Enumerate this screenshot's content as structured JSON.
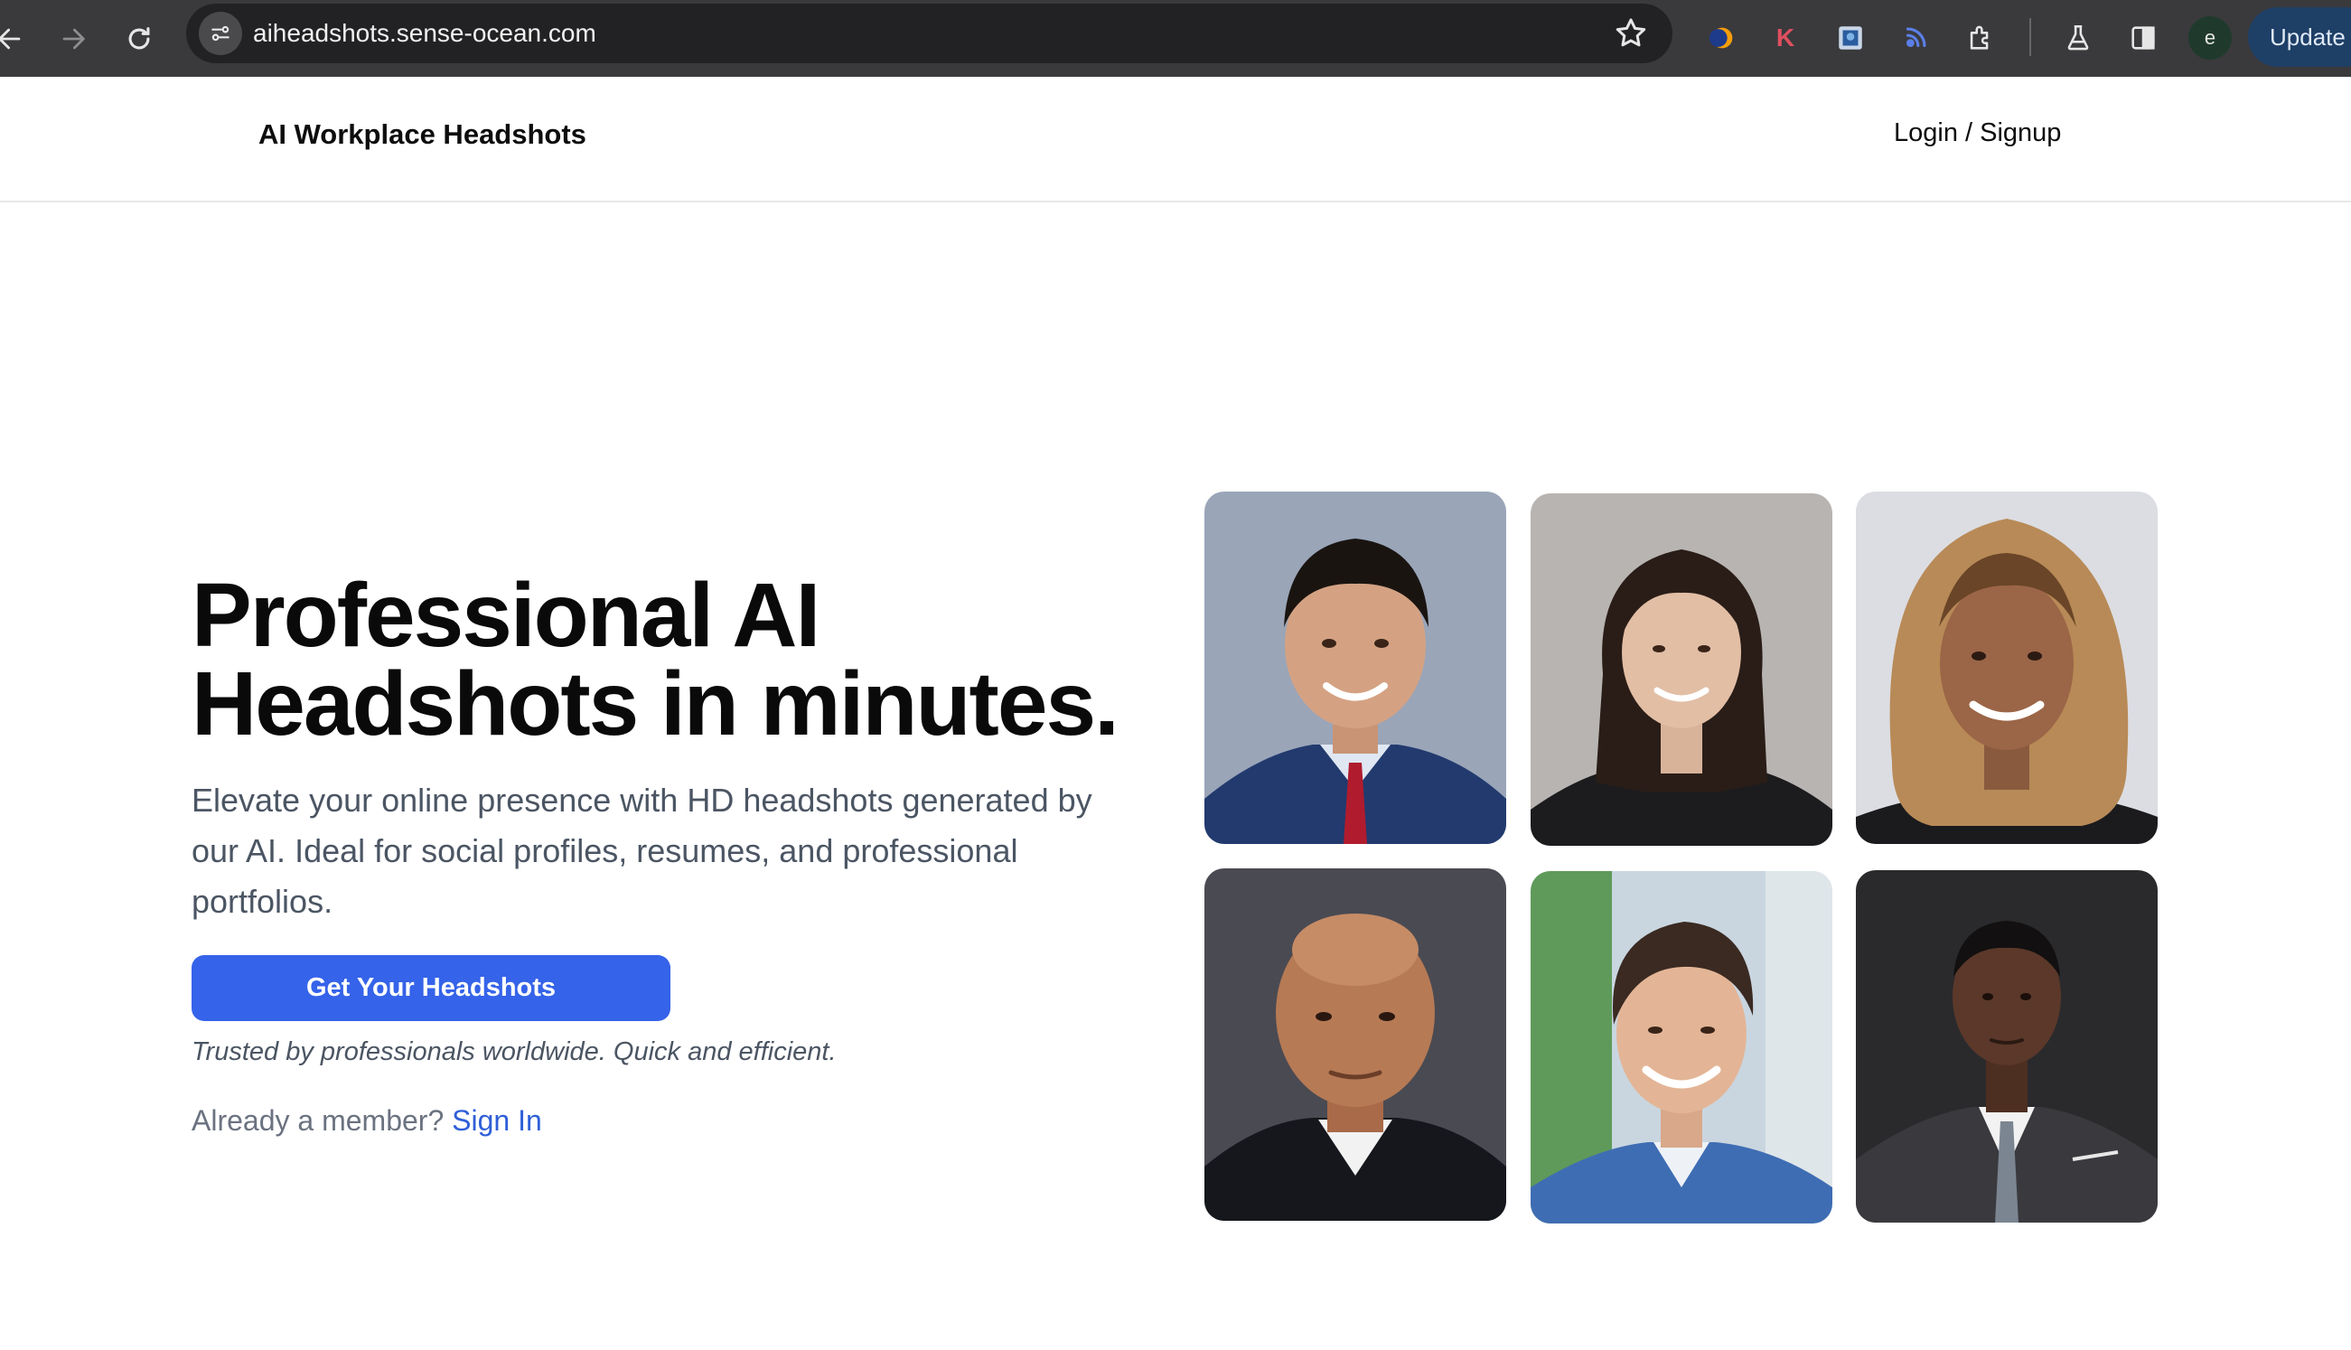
{
  "browser": {
    "url": "aiheadshots.sense-ocean.com",
    "update_label": "Update",
    "profile_initial": "e",
    "extension_k_label": "K",
    "icons": [
      "back-icon",
      "forward-icon",
      "reload-icon",
      "site-info-icon",
      "bookmark-star-icon",
      "extension-icon",
      "labs-flask-icon",
      "side-panel-icon"
    ]
  },
  "header": {
    "brand": "AI Workplace Headshots",
    "login_label": "Login / Signup"
  },
  "hero": {
    "title_line1": "Professional AI",
    "title_line2": "Headshots in minutes.",
    "subtitle": "Elevate your online presence with HD headshots generated by our AI. Ideal for social profiles, resumes, and professional portfolios.",
    "cta_label": "Get Your Headshots",
    "trusted_text": "Trusted by professionals worldwide. Quick and efficient.",
    "member_text": "Already a member?",
    "signin_label": "Sign In"
  },
  "colors": {
    "accent": "#3563e9",
    "link": "#2f5fd8",
    "body_text": "#4b5563"
  }
}
